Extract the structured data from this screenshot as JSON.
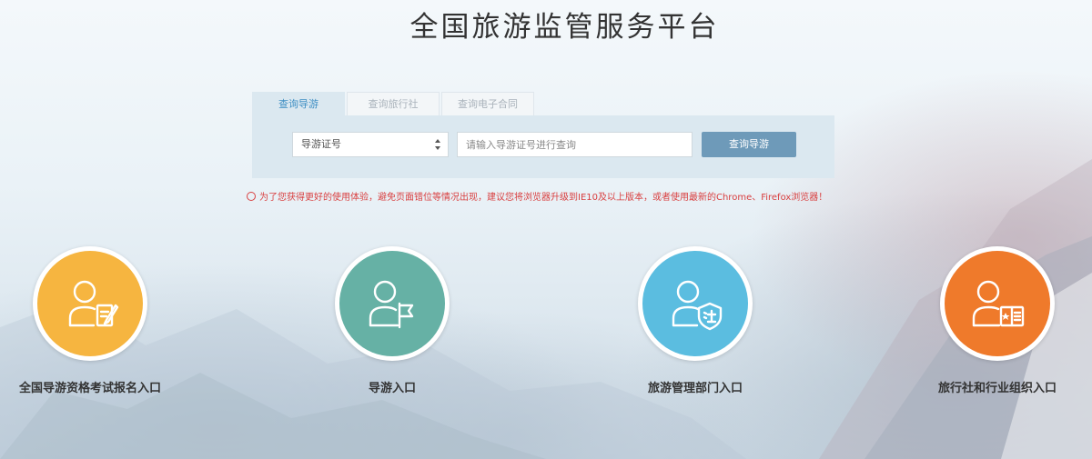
{
  "page": {
    "title": "全国旅游监管服务平台"
  },
  "search": {
    "tabs": [
      {
        "label": "查询导游",
        "active": true
      },
      {
        "label": "查询旅行社",
        "active": false
      },
      {
        "label": "查询电子合同",
        "active": false
      }
    ],
    "select_value": "导游证号",
    "input_placeholder": "请输入导游证号进行查询",
    "button_label": "查询导游"
  },
  "warning": {
    "text": "为了您获得更好的使用体验，避免页面错位等情况出现，建议您将浏览器升级到IE10及以上版本，或者使用最新的Chrome、Firefox浏览器！"
  },
  "entries": [
    {
      "label": "全国导游资格考试报名入口",
      "color": "#f6b540",
      "icon": "person-edit-icon"
    },
    {
      "label": "导游入口",
      "color": "#66b1a5",
      "icon": "person-flag-icon"
    },
    {
      "label": "旅游管理部门入口",
      "color": "#5bbde0",
      "icon": "person-law-shield-icon"
    },
    {
      "label": "旅行社和行业组织入口",
      "color": "#ef7a2b",
      "icon": "person-certificate-icon"
    }
  ]
}
